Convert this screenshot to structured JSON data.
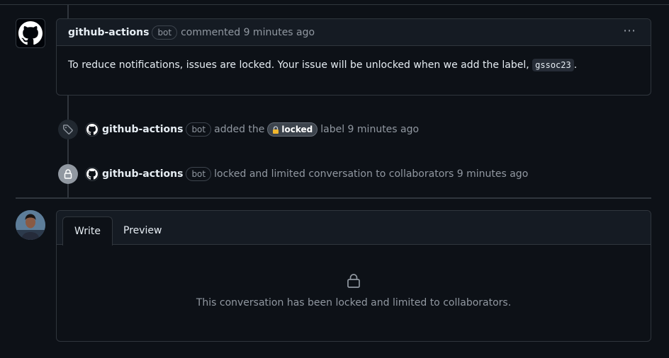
{
  "comment": {
    "author": "github-actions",
    "bot_badge": "bot",
    "action_text": "commented 9 minutes ago",
    "menu_icon": "kebab-horizontal-icon",
    "body_text": "To reduce notifications, issues are locked. Your issue will be unlocked when we add the label,",
    "body_code": "gssoc23",
    "body_end": "."
  },
  "events": [
    {
      "icon": "tag-icon",
      "author": "github-actions",
      "bot_badge": "bot",
      "text_before": "added the",
      "label_name": "locked",
      "text_after": "label 9 minutes ago"
    },
    {
      "icon": "lock-icon",
      "author": "github-actions",
      "bot_badge": "bot",
      "text": "locked and limited conversation to collaborators 9 minutes ago"
    }
  ],
  "editor": {
    "tabs": [
      {
        "label": "Write",
        "active": true
      },
      {
        "label": "Preview",
        "active": false
      }
    ],
    "locked_icon": "lock-icon",
    "locked_message": "This conversation has been locked and limited to collaborators."
  },
  "colors": {
    "background": "#0d1117",
    "border": "#30363d",
    "muted_text": "#9198a1",
    "label_locked_bg": "#3d444d",
    "lock_emoji": "#f0b72f"
  }
}
